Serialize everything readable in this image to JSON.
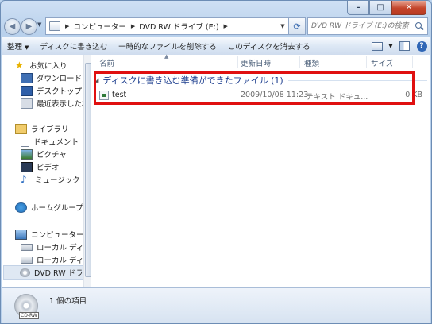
{
  "address": {
    "segments": [
      "コンピューター",
      "DVD RW ドライブ (E:)"
    ],
    "search_placeholder": "DVD RW ドライブ (E:)の検索"
  },
  "toolbar": {
    "organize": "整理",
    "burn": "ディスクに書き込む",
    "delete_temp": "一時的なファイルを削除する",
    "erase": "このディスクを消去する"
  },
  "sidebar": {
    "favorites": "お気に入り",
    "downloads": "ダウンロード",
    "desktop": "デスクトップ",
    "recent": "最近表示した場所",
    "libraries": "ライブラリ",
    "documents": "ドキュメント",
    "pictures": "ピクチャ",
    "videos": "ビデオ",
    "music": "ミュージック",
    "homegroup": "ホームグループ",
    "computer": "コンピューター",
    "local_disk_c": "ローカル ディスク",
    "local_disk_d": "ローカル ディスク",
    "dvd": "DVD RW ドライブ"
  },
  "columns": {
    "name": "名前",
    "date": "更新日時",
    "type": "種類",
    "size": "サイズ"
  },
  "group": {
    "title": "ディスクに書き込む準備ができたファイル (1)"
  },
  "file": {
    "name": "test",
    "date": "2009/10/08 11:23",
    "type": "テキスト ドキュ...",
    "size": "0 KB"
  },
  "details": {
    "status": "1 個の項目",
    "disc_label": "CD-RW"
  }
}
